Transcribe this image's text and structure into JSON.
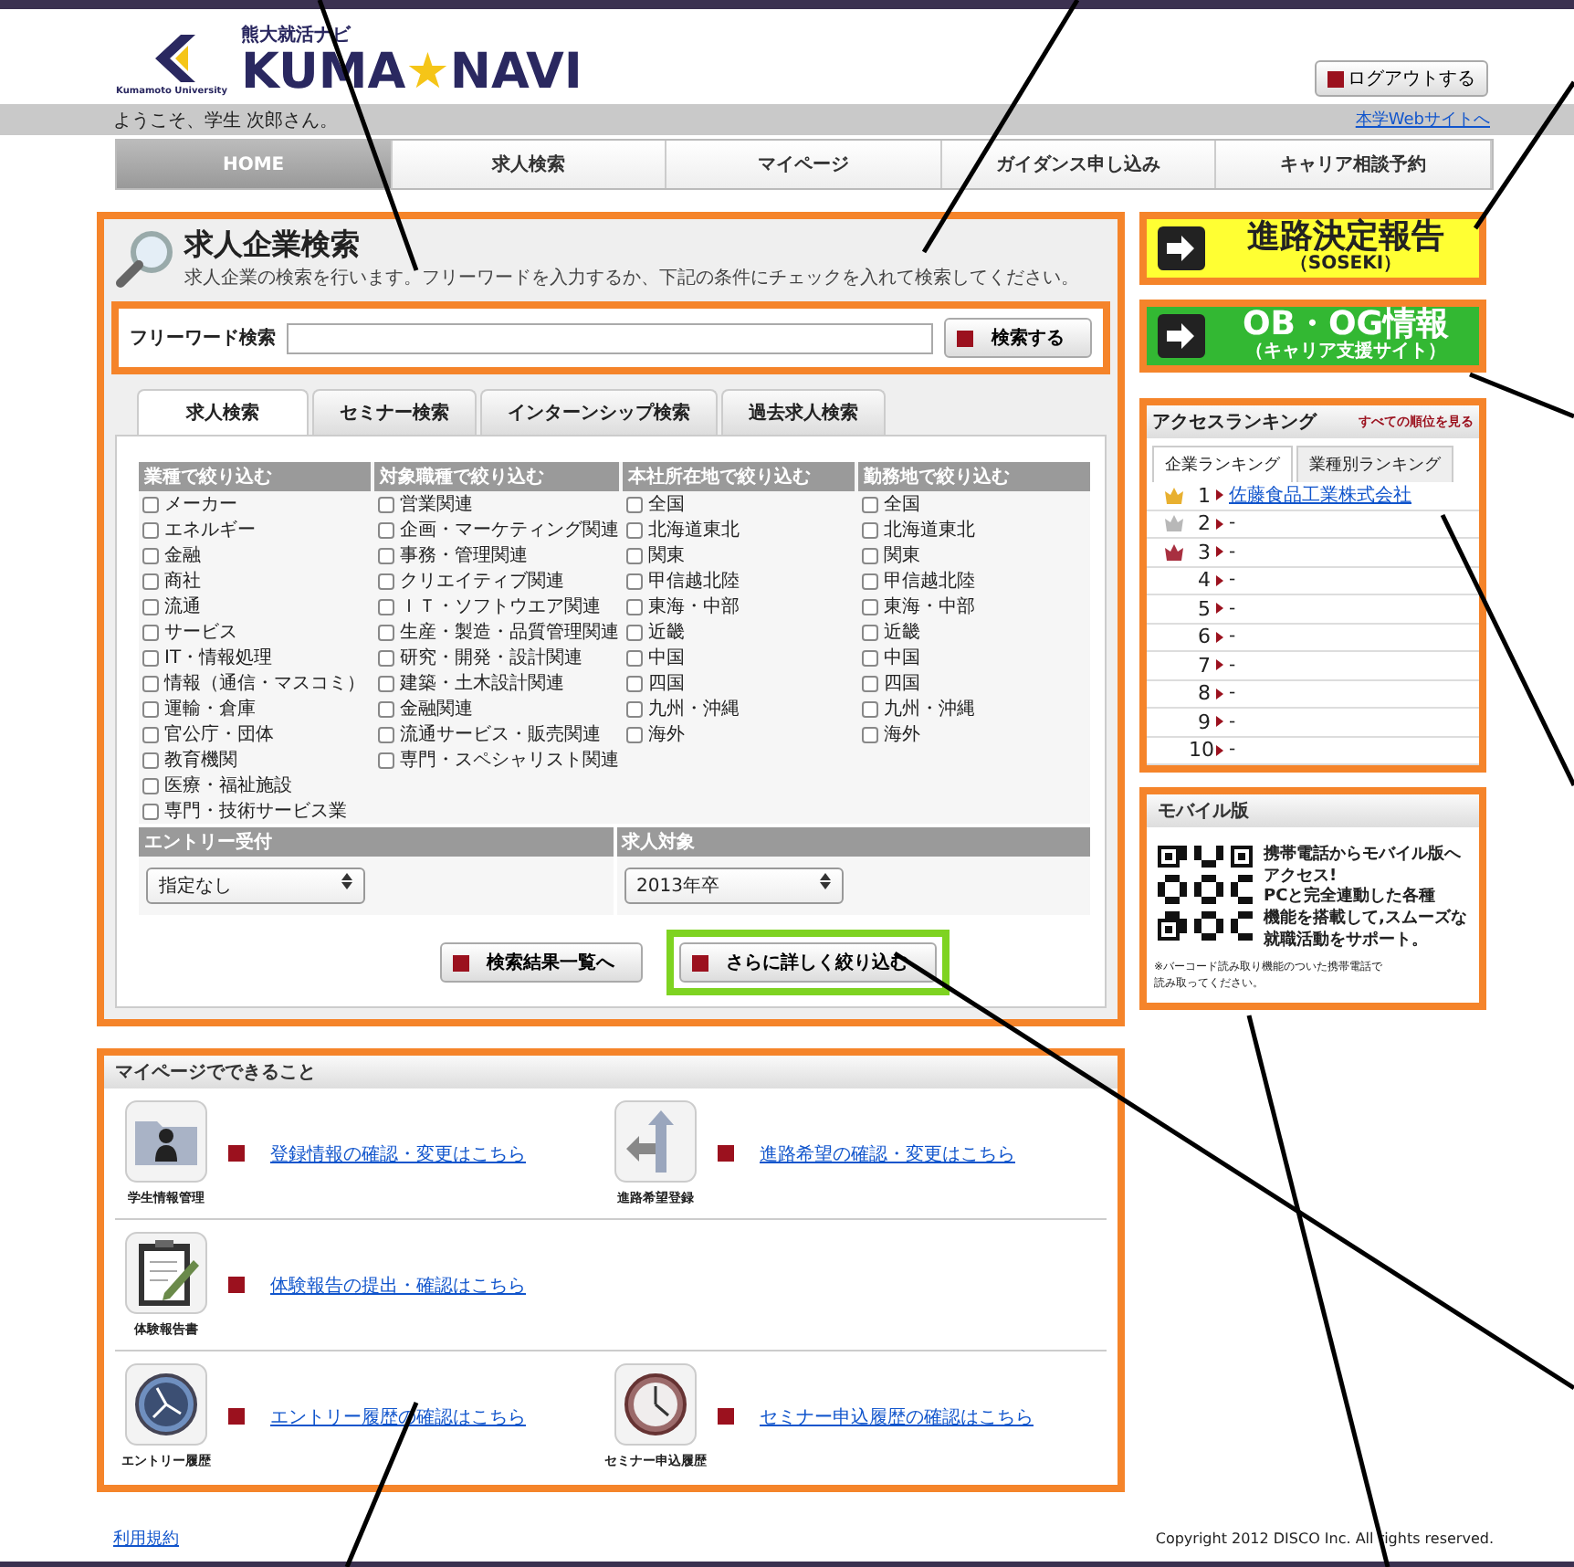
{
  "header": {
    "university": "Kumamoto University",
    "tagline": "熊大就活ナビ",
    "name_left": "KUMA",
    "star": "★",
    "name_right": "NAVI",
    "logout_button": "ログアウトする"
  },
  "welcome": "ようこそ、学生 次郎さん。",
  "site_link": "本学Webサイトへ",
  "nav": [
    {
      "label": "HOME",
      "selected": true
    },
    {
      "label": "求人検索",
      "selected": false
    },
    {
      "label": "マイページ",
      "selected": false
    },
    {
      "label": "ガイダンス申し込み",
      "selected": false
    },
    {
      "label": "キャリア相談予約",
      "selected": false
    }
  ],
  "search": {
    "title": "求人企業検索",
    "description": "求人企業の検索を行います。フリーワードを入力するか、下記の条件にチェックを入れて検索してください。",
    "freeword": {
      "label": "フリーワード検索",
      "button": "検索する"
    },
    "tabs": [
      {
        "label": "求人検索",
        "selected": true
      },
      {
        "label": "セミナー検索",
        "selected": false
      },
      {
        "label": "インターンシップ検索",
        "selected": false
      },
      {
        "label": "過去求人検索",
        "selected": false
      }
    ],
    "filters": [
      {
        "heading": "業種で絞り込む",
        "options": [
          {
            "label": "メーカー",
            "checked": false
          },
          {
            "label": "エネルギー",
            "checked": false
          },
          {
            "label": "金融",
            "checked": false
          },
          {
            "label": "商社",
            "checked": false
          },
          {
            "label": "流通",
            "checked": false
          },
          {
            "label": "サービス",
            "checked": false
          },
          {
            "label": "IT・情報処理",
            "checked": false
          },
          {
            "label": "情報（通信・マスコミ）",
            "checked": false
          },
          {
            "label": "運輸・倉庫",
            "checked": false
          },
          {
            "label": "官公庁・団体",
            "checked": false
          },
          {
            "label": "教育機関",
            "checked": false
          },
          {
            "label": "医療・福祉施設",
            "checked": false
          },
          {
            "label": "専門・技術サービス業",
            "checked": false
          }
        ]
      },
      {
        "heading": "対象職種で絞り込む",
        "options": [
          {
            "label": "営業関連",
            "checked": false
          },
          {
            "label": "企画・マーケティング関連",
            "checked": false
          },
          {
            "label": "事務・管理関連",
            "checked": false
          },
          {
            "label": "クリエイティブ関連",
            "checked": false
          },
          {
            "label": "ＩＴ・ソフトウエア関連",
            "checked": false
          },
          {
            "label": "生産・製造・品質管理関連",
            "checked": false
          },
          {
            "label": "研究・開発・設計関連",
            "checked": false
          },
          {
            "label": "建築・土木設計関連",
            "checked": false
          },
          {
            "label": "金融関連",
            "checked": false
          },
          {
            "label": "流通サービス・販売関連",
            "checked": false
          },
          {
            "label": "専門・スペシャリスト関連",
            "checked": false
          }
        ]
      },
      {
        "heading": "本社所在地で絞り込む",
        "options": [
          {
            "label": "全国",
            "checked": false
          },
          {
            "label": "北海道東北",
            "checked": false
          },
          {
            "label": "関東",
            "checked": false
          },
          {
            "label": "甲信越北陸",
            "checked": false
          },
          {
            "label": "東海・中部",
            "checked": false
          },
          {
            "label": "近畿",
            "checked": false
          },
          {
            "label": "中国",
            "checked": false
          },
          {
            "label": "四国",
            "checked": false
          },
          {
            "label": "九州・沖縄",
            "checked": false
          },
          {
            "label": "海外",
            "checked": false
          }
        ]
      },
      {
        "heading": "勤務地で絞り込む",
        "options": [
          {
            "label": "全国",
            "checked": false
          },
          {
            "label": "北海道東北",
            "checked": false
          },
          {
            "label": "関東",
            "checked": false
          },
          {
            "label": "甲信越北陸",
            "checked": false
          },
          {
            "label": "東海・中部",
            "checked": false
          },
          {
            "label": "近畿",
            "checked": false
          },
          {
            "label": "中国",
            "checked": false
          },
          {
            "label": "四国",
            "checked": false
          },
          {
            "label": "九州・沖縄",
            "checked": false
          },
          {
            "label": "海外",
            "checked": false
          }
        ]
      }
    ],
    "selects": [
      {
        "heading": "エントリー受付",
        "value": "指定なし"
      },
      {
        "heading": "求人対象",
        "value": "2013年卒"
      }
    ],
    "buttons": [
      {
        "label": "検索結果一覧へ",
        "highlighted": false
      },
      {
        "label": "さらに詳しく絞り込む",
        "highlighted": true
      }
    ]
  },
  "banners": [
    {
      "kind": "light",
      "title": "進路決定報告",
      "subtitle": "（SOSEKI）",
      "color": "#ffff33"
    },
    {
      "kind": "dark",
      "title": "OB・OG情報",
      "subtitle": "（キャリア支援サイト）",
      "color": "#33b833"
    }
  ],
  "ranking": {
    "title": "アクセスランキング",
    "all_link": "すべての順位を見る",
    "tabs": [
      {
        "label": "企業ランキング",
        "selected": true
      },
      {
        "label": "業種別ランキング",
        "selected": false
      }
    ],
    "rows": [
      {
        "rank": "1",
        "company": "佐藤食品工業株式会社",
        "linked": true,
        "color": "#e8b030"
      },
      {
        "rank": "2",
        "company": "-",
        "linked": false,
        "color": "#b8b8b8"
      },
      {
        "rank": "3",
        "company": "-",
        "linked": false,
        "color": "#a83040"
      },
      {
        "rank": "4",
        "company": "-",
        "linked": false
      },
      {
        "rank": "5",
        "company": "-",
        "linked": false
      },
      {
        "rank": "6",
        "company": "-",
        "linked": false
      },
      {
        "rank": "7",
        "company": "-",
        "linked": false
      },
      {
        "rank": "8",
        "company": "-",
        "linked": false
      },
      {
        "rank": "9",
        "company": "-",
        "linked": false
      },
      {
        "rank": "10",
        "company": "-",
        "linked": false
      }
    ]
  },
  "mobile": {
    "title": "モバイル版",
    "lines": [
      "携帯電話からモバイル版へ",
      "アクセス!",
      "PCと完全連動した各種",
      "機能を搭載して,スムーズな",
      "就職活動をサポート。"
    ],
    "note_lines": [
      "※バーコード読み取り機能のついた携帯電話で",
      "読み取ってください。"
    ]
  },
  "mypage": {
    "title": "マイページでできること",
    "rows": [
      [
        {
          "kind": "person",
          "caption": "学生情報管理",
          "link": "登録情報の確認・変更はこちら"
        },
        {
          "kind": "route",
          "caption": "進路希望登録",
          "link": "進路希望の確認・変更はこちら"
        }
      ],
      [
        {
          "kind": "clipboard",
          "caption": "体験報告書",
          "link": "体験報告の提出・確認はこちら"
        }
      ],
      [
        {
          "kind": "compass",
          "caption": "エントリー履歴",
          "link": "エントリー履歴の確認はこちら"
        },
        {
          "kind": "clock",
          "caption": "セミナー申込履歴",
          "link": "セミナー申込履歴の確認はこちら"
        }
      ]
    ]
  },
  "footer": {
    "terms": "利用規約",
    "copyright": "Copyright 2012 DISCO Inc. All rights reserved."
  }
}
